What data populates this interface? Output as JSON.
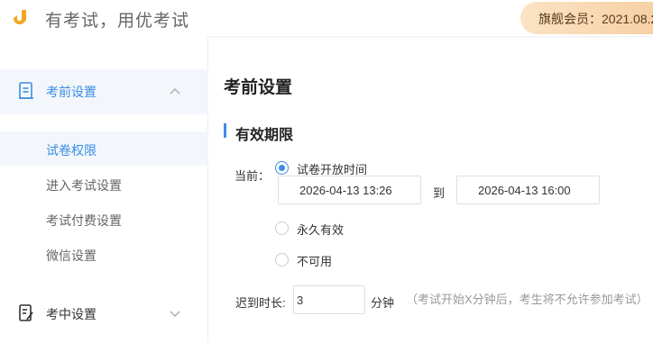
{
  "header": {
    "slogan": "有考试，用优考试",
    "member_text": "旗舰会员：2021.08.2"
  },
  "sidebar": {
    "groups": [
      {
        "label": "考前设置",
        "expanded": true
      },
      {
        "label": "考中设置",
        "expanded": false
      }
    ],
    "sub_items": [
      {
        "label": "试卷权限",
        "active": true
      },
      {
        "label": "进入考试设置"
      },
      {
        "label": "考试付费设置"
      },
      {
        "label": "微信设置"
      }
    ]
  },
  "main": {
    "title": "考前设置",
    "section_title": "有效期限",
    "current_label": "当前：",
    "options": [
      {
        "label": "试卷开放时间",
        "checked": true
      },
      {
        "label": "永久有效",
        "checked": false
      },
      {
        "label": "不可用",
        "checked": false
      }
    ],
    "start_time": "2026-04-13 13:26",
    "to_label": "到",
    "end_time": "2026-04-13 16:00",
    "late_label": "迟到时长:",
    "late_value": "3",
    "late_unit": "分钟",
    "late_hint": "（考试开始X分钟后，考生将不允许参加考试）"
  },
  "colors": {
    "accent": "#3a8ee6",
    "member_badge": "#f6cfa2"
  }
}
